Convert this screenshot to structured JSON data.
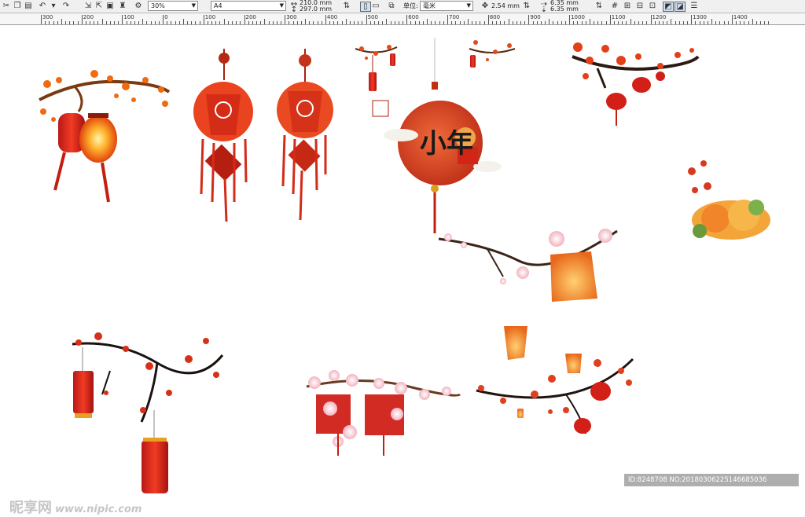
{
  "toolbar": {
    "zoom": "30%",
    "page_size": "A4",
    "width_value": "210.0 mm",
    "height_value": "297.0 mm",
    "unit_label": "单位:",
    "unit_value": "毫米",
    "nudge_value": "2.54 mm",
    "dup_x": "6.35 mm",
    "dup_y": "6.35 mm"
  },
  "ruler": {
    "labels": [
      "300",
      "200",
      "100",
      "0",
      "100",
      "200",
      "300",
      "400",
      "500",
      "600",
      "700",
      "800",
      "900",
      "1000",
      "1100",
      "1200",
      "1300",
      "1400"
    ]
  },
  "art": {
    "xiaonian_text": "小年"
  },
  "watermark": {
    "brand": "昵享网",
    "url": "www.nipic.com",
    "id_text": "ID:8248708 NO:20180306225146685036"
  }
}
